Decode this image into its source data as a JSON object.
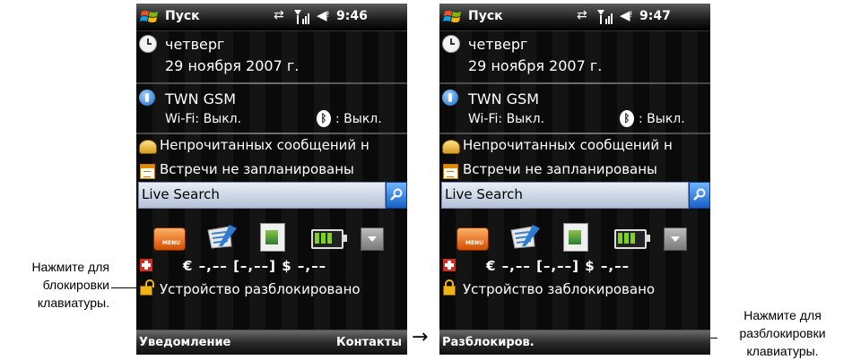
{
  "callouts": {
    "left": {
      "line1": "Нажмите для",
      "line2": "блокировки",
      "line3": "клавиатуры."
    },
    "right": {
      "line1": "Нажмите для",
      "line2": "разблокировки",
      "line3": "клавиатуры."
    }
  },
  "arrow": "→",
  "phones": [
    {
      "status": {
        "start_label": "Пуск",
        "time": "9:46"
      },
      "today": {
        "day": "четверг",
        "date": "29 ноября 2007 г.",
        "network": "TWN GSM",
        "wifi": "Wi-Fi: Выкл.",
        "bluetooth": ": Выкл.",
        "messages": "Непрочитанных сообщений н",
        "appointments": "Встречи не запланированы",
        "search_label": "Live Search",
        "currency": "€ –,–– [–,––] $ –,––",
        "lock_status": "Устройство разблокировано"
      },
      "softkeys": {
        "left": "Уведомление",
        "right": "Контакты"
      }
    },
    {
      "status": {
        "start_label": "Пуск",
        "time": "9:47"
      },
      "today": {
        "day": "четверг",
        "date": "29 ноября 2007 г.",
        "network": "TWN GSM",
        "wifi": "Wi-Fi: Выкл.",
        "bluetooth": ": Выкл.",
        "messages": "Непрочитанных сообщений н",
        "appointments": "Встречи не запланированы",
        "search_label": "Live Search",
        "currency": "€ –,–– [–,––] $ –,––",
        "lock_status": "Устройство заблокировано"
      },
      "softkeys": {
        "left": "Разблокиров.",
        "right": ""
      }
    }
  ],
  "icons": {
    "start": "windows-flag-icon",
    "sync": "sync-arrows-icon",
    "signal": "signal-strength-icon",
    "volume": "speaker-icon",
    "date": "clock-icon",
    "network": "antenna-icon",
    "bluetooth": "bluetooth-icon",
    "messages": "envelope-icon",
    "calendar": "calendar-icon",
    "search": "magnifier-icon",
    "lock": "padlock-icon"
  },
  "colors": {
    "background": "#0a0a0a",
    "search_accent": "#1860c8",
    "lock": "#f1b416",
    "battery": "#7cd321"
  }
}
